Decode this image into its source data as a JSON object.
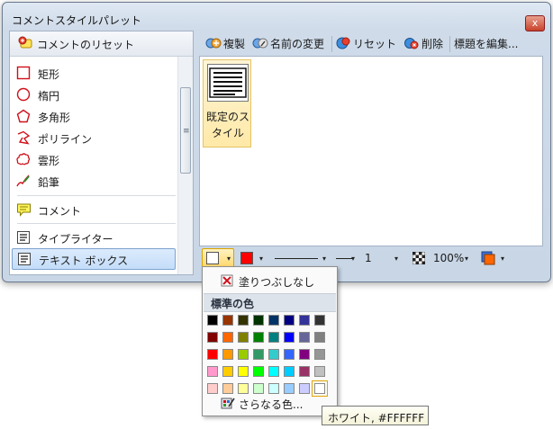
{
  "window": {
    "title": "コメントスタイルパレット",
    "close_glyph": "x"
  },
  "left_panel": {
    "header_label": "コメントのリセット",
    "items": [
      {
        "label": "矩形",
        "icon": "rectangle-icon"
      },
      {
        "label": "楕円",
        "icon": "ellipse-icon"
      },
      {
        "label": "多角形",
        "icon": "polygon-icon"
      },
      {
        "label": "ポリライン",
        "icon": "polyline-icon"
      },
      {
        "label": "雲形",
        "icon": "cloud-icon"
      },
      {
        "label": "鉛筆",
        "icon": "pencil-icon"
      },
      {
        "label": "コメント",
        "icon": "comment-icon"
      },
      {
        "label": "タイプライター",
        "icon": "typewriter-icon"
      },
      {
        "label": "テキスト ボックス",
        "icon": "textbox-icon",
        "selected": true
      }
    ],
    "scroll_grip": "≡"
  },
  "toolbar": {
    "duplicate": "複製",
    "rename": "名前の変更",
    "reset": "リセット",
    "delete": "削除",
    "edit_title": "標題を編集..."
  },
  "style_tile": {
    "label": "既定のス\nタイル"
  },
  "bottombar": {
    "fill_color": "#ffffff",
    "stroke_color": "#ff0000",
    "line_width": "1",
    "opacity": "100%",
    "text_color": "#ff6600",
    "arrow_glyph": "▾"
  },
  "popup": {
    "no_fill": "塗りつぶしなし",
    "standard_colors_header": "標準の色",
    "more_colors": "さらなる色...",
    "colors": [
      [
        "#000000",
        "#993300",
        "#333300",
        "#003300",
        "#003366",
        "#000080",
        "#333399",
        "#333333"
      ],
      [
        "#800000",
        "#ff6600",
        "#808000",
        "#008000",
        "#008080",
        "#0000ff",
        "#666699",
        "#808080"
      ],
      [
        "#ff0000",
        "#ff9900",
        "#99cc00",
        "#339966",
        "#33cccc",
        "#3366ff",
        "#800080",
        "#969696"
      ],
      [
        "#ff99cc",
        "#ffcc00",
        "#ffff00",
        "#00ff00",
        "#00ffff",
        "#00ccff",
        "#993366",
        "#c0c0c0"
      ],
      [
        "#ffcccc",
        "#ffcc99",
        "#ffff99",
        "#ccffcc",
        "#ccffff",
        "#99ccff",
        "#ccccff",
        "#ffffff"
      ]
    ]
  },
  "tooltip": {
    "text": "ホワイト, #FFFFFF"
  }
}
